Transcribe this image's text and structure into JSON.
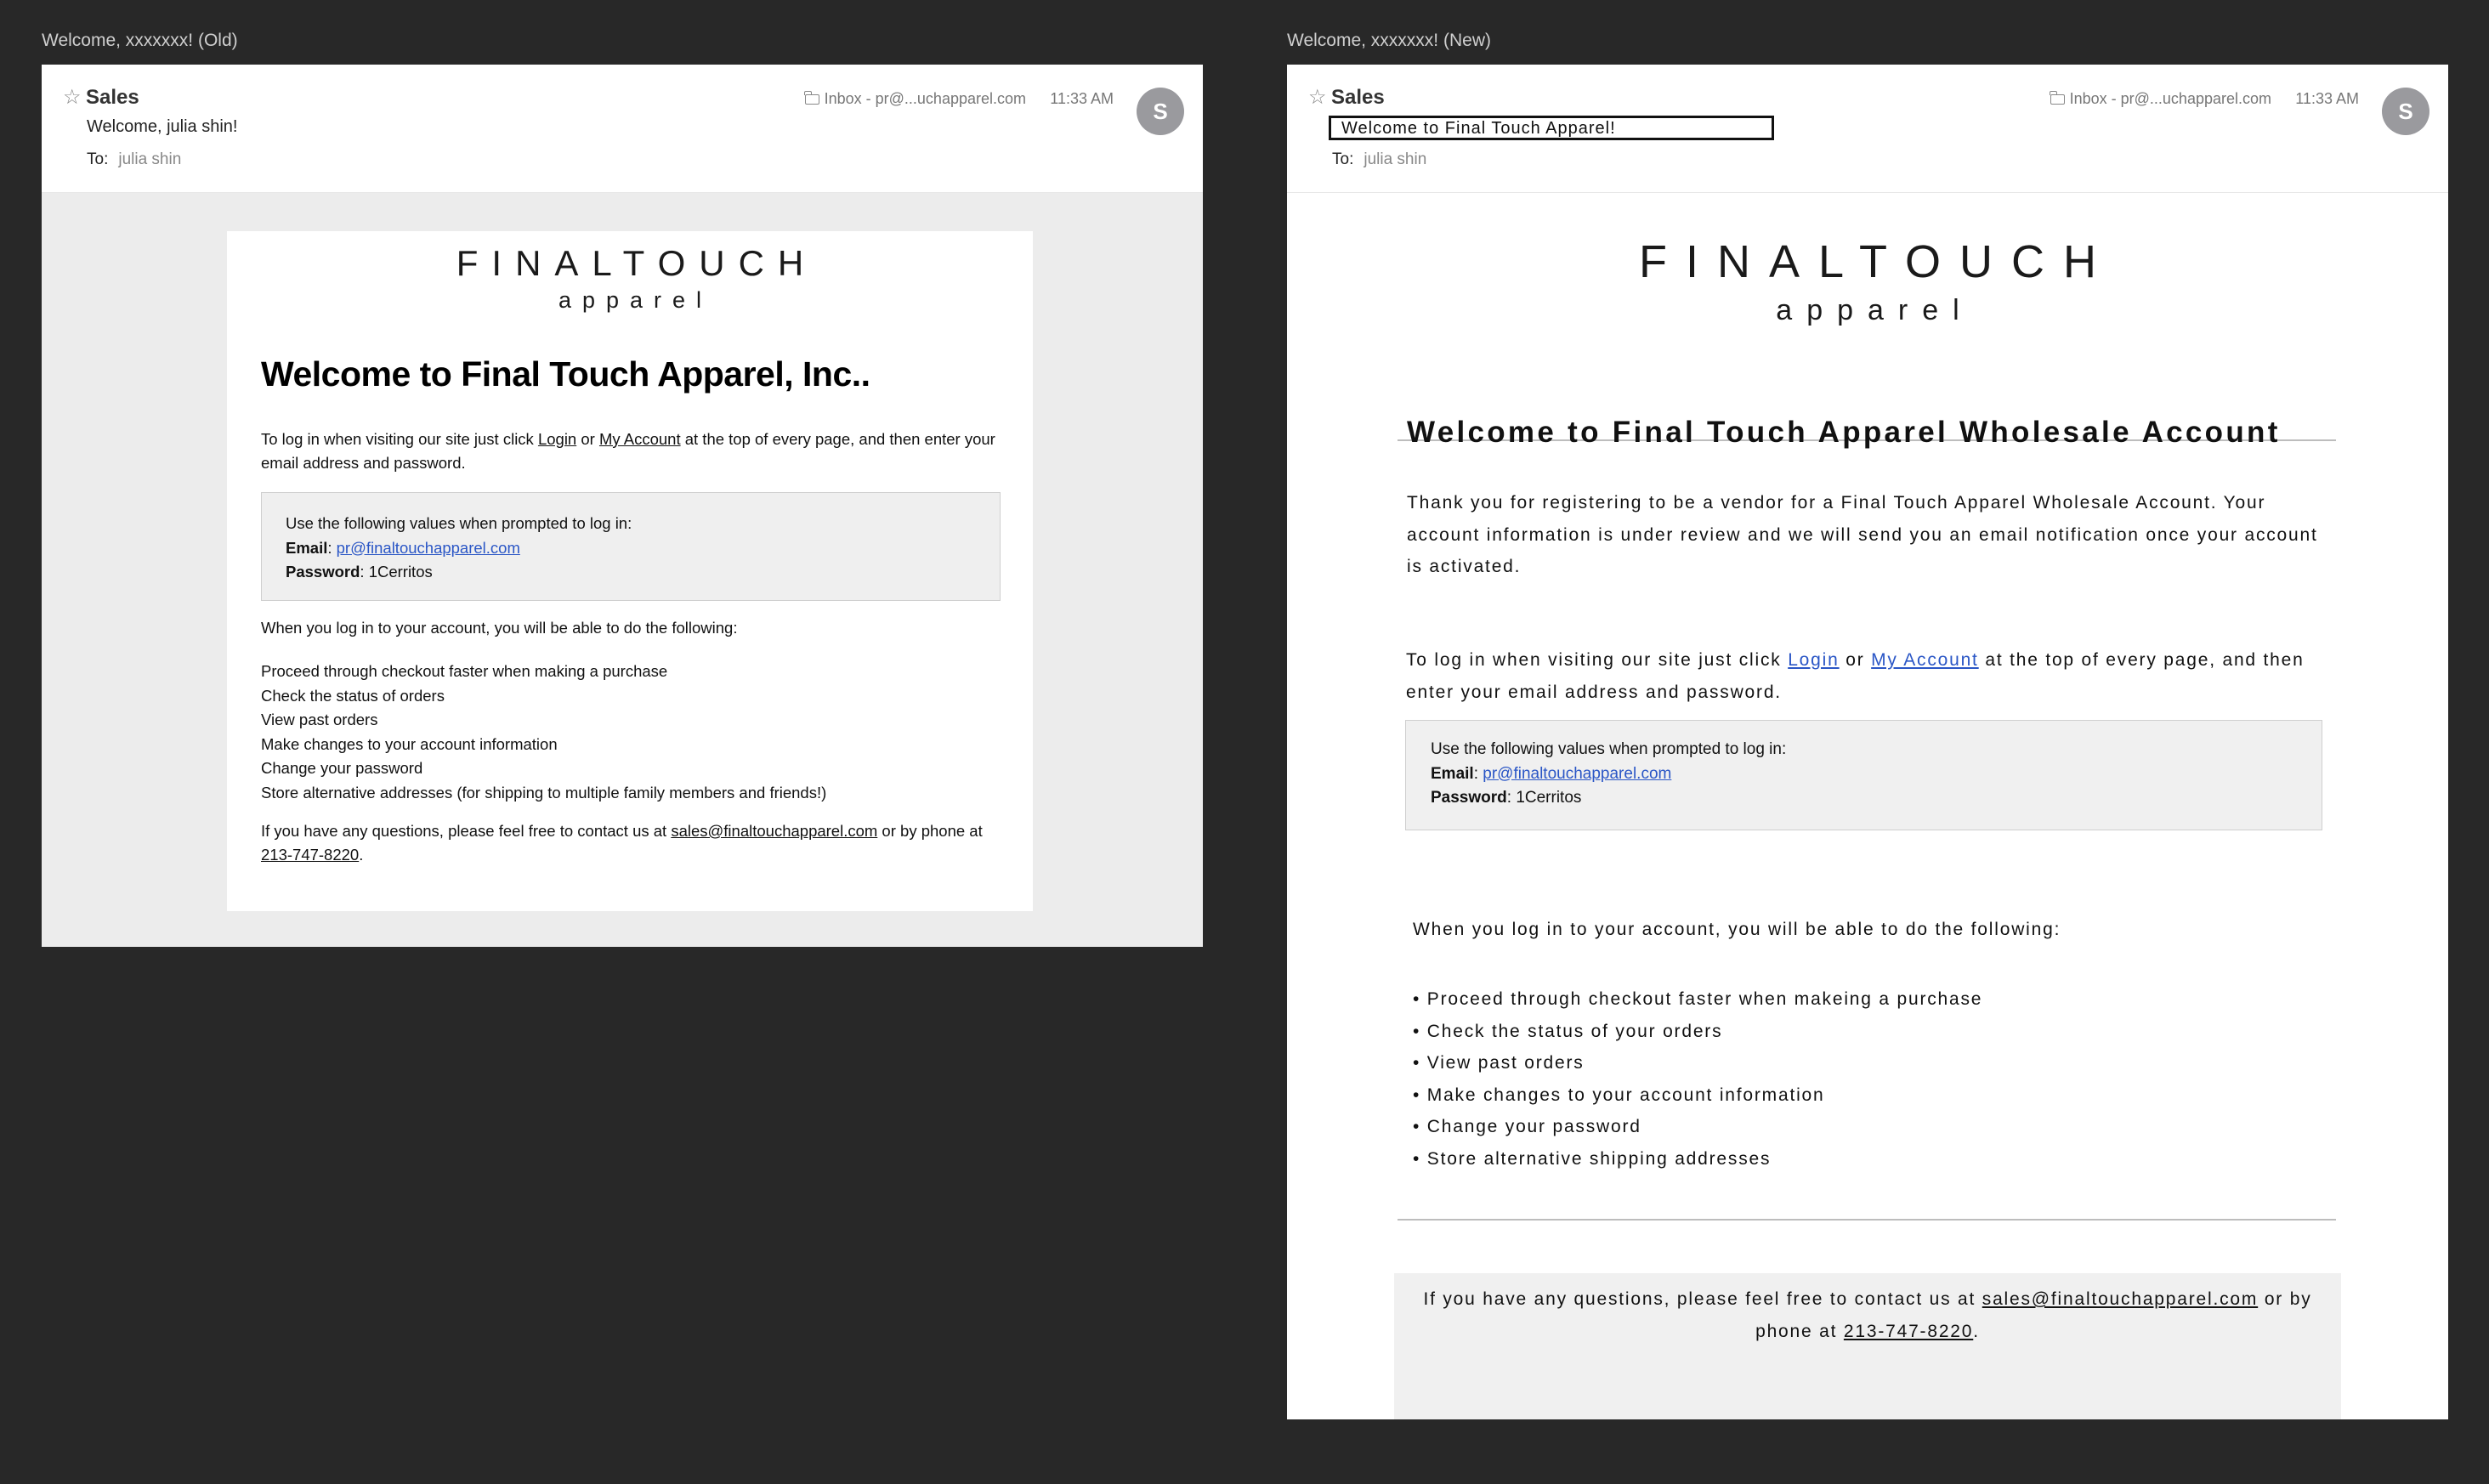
{
  "old": {
    "frame_label": "Welcome, xxxxxxx! (Old)",
    "header": {
      "star": "☆",
      "sender": "Sales",
      "subject": "Welcome, julia shin!",
      "to_label": "To:",
      "to_value": "julia shin",
      "folder": "Inbox - pr@...uchapparel.com",
      "time": "11:33 AM",
      "avatar": "S"
    },
    "logo_main": "FINALTOUCH",
    "logo_sub": "apparel",
    "heading": "Welcome to Final Touch Apparel, Inc..",
    "intro": {
      "before": "To log in when visiting our site just click ",
      "login": "Login",
      "or": " or ",
      "my_account": "My Account",
      "after": " at the top of every page, and then enter your email address and password."
    },
    "creds": {
      "lead": "Use the following values when prompted to log in:",
      "email_label": "Email",
      "email_value": "pr@finaltouchapparel.com",
      "password_label": "Password",
      "password_value": "1Cerritos"
    },
    "able_text": "When you log in to your account, you will be able to do the following:",
    "list": [
      "Proceed through checkout faster when making a purchase",
      "Check the status of orders",
      "View past orders",
      "Make changes to your account information",
      "Change your password",
      "Store alternative addresses (for shipping to multiple family members and friends!)"
    ],
    "contact": {
      "before": "If you have any questions, please feel free to contact us at ",
      "email": "sales@finaltouchapparel.com",
      "mid": " or by phone at ",
      "phone": "213-747-8220",
      "end": "."
    }
  },
  "new": {
    "frame_label": "Welcome, xxxxxxx! (New)",
    "header": {
      "star": "☆",
      "sender": "Sales",
      "subject": "Welcome to Final Touch Apparel!",
      "to_label": "To:",
      "to_value": "julia shin",
      "folder": "Inbox - pr@...uchapparel.com",
      "time": "11:33 AM",
      "avatar": "S"
    },
    "logo_main": "FINALTOUCH",
    "logo_sub": "apparel",
    "heading": "Welcome to Final Touch Apparel Wholesale Account",
    "thanks": "Thank you for registering to be a vendor for a Final Touch Apparel Wholesale Account. Your account information is under review and we will send you an email notification once your account is activated.",
    "intro": {
      "before": "To log in when visiting our site just click ",
      "login": "Login",
      "or": " or ",
      "my_account": "My Account",
      "after": " at the top of every page, and then enter your email address and password."
    },
    "creds": {
      "lead": "Use the following values when prompted to log in:",
      "email_label": "Email",
      "email_value": "pr@finaltouchapparel.com",
      "password_label": "Password",
      "password_value": "1Cerritos"
    },
    "able_text": "When you log in to your account, you will be able to do the following:",
    "list": [
      "• Proceed through checkout faster when makeing a purchase",
      "• Check the status of your orders",
      "• View past orders",
      "• Make changes to your account information",
      "• Change your password",
      "• Store alternative shipping addresses"
    ],
    "contact": {
      "before": "If you have any questions, please feel free to contact us at ",
      "email": "sales@finaltouchapparel.com",
      "mid": " or by phone at ",
      "phone": "213-747-8220",
      "end": "."
    }
  }
}
